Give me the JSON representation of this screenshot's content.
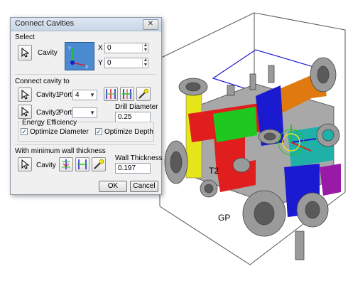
{
  "dialog": {
    "title": "Connect Cavities",
    "close_glyph": "✕",
    "select": {
      "heading": "Select",
      "cavity_label": "Cavity",
      "x_label": "X",
      "x_value": "0",
      "y_label": "Y",
      "y_value": "0"
    },
    "connect": {
      "heading": "Connect cavity to",
      "cavity1_label": "Cavity1",
      "port_label_1": "Port",
      "port1_value": "4",
      "cavity2_label": "Cavity2",
      "port_label_2": "Port",
      "port2_value": "",
      "drill_label": "Drill Diameter",
      "drill_value": "0.25"
    },
    "energy": {
      "heading": "Energy Efficiency",
      "optimize_diameter_label": "Optimize Diameter",
      "optimize_diameter_checked": true,
      "optimize_depth_label": "Optimize Depth",
      "optimize_depth_checked": true
    },
    "wall": {
      "heading": "With minimum wall thickness",
      "cavity_label": "Cavity",
      "wall_label": "Wall Thickness",
      "wall_value": "0.197"
    },
    "ok_label": "OK",
    "cancel_label": "Cancel"
  },
  "viewport": {
    "labels": [
      "T2",
      "GP"
    ]
  },
  "colors": {
    "red": "#e01e1e",
    "green": "#1fc81f",
    "yellow": "#e6e61a",
    "blue": "#1a1ad0",
    "orange": "#e07a10",
    "purple": "#9a1aa8",
    "teal": "#1fb0a8",
    "gray": "#9a9a9a"
  }
}
